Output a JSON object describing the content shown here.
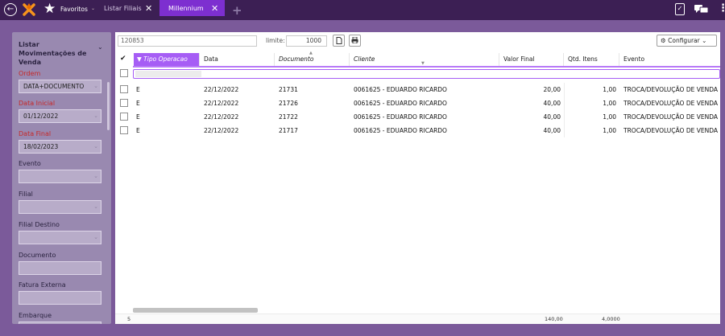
{
  "topbar": {
    "favorites_label": "Favoritos",
    "tabs": [
      {
        "label": "Listar Filiais",
        "active": false
      },
      {
        "label": "Millennium",
        "active": true
      }
    ],
    "close_glyph": "✕",
    "add_glyph": "+"
  },
  "left_panel": {
    "title": "Listar Movimentações de Venda",
    "fields": [
      {
        "label": "Ordem",
        "value": "DATA+DOCUMENTO",
        "required": true
      },
      {
        "label": "Data Inicial",
        "value": "01/12/2022",
        "required": true
      },
      {
        "label": "Data Final",
        "value": "18/02/2023",
        "required": true
      },
      {
        "label": "Evento",
        "value": "",
        "required": false
      },
      {
        "label": "Filial",
        "value": "",
        "required": false
      },
      {
        "label": "Filial Destino",
        "value": "",
        "required": false
      },
      {
        "label": "Documento",
        "value": "",
        "required": false
      },
      {
        "label": "Fatura Externa",
        "value": "",
        "required": false
      },
      {
        "label": "Embarque",
        "value": "",
        "required": false
      }
    ]
  },
  "toolbar": {
    "search_value": "120853",
    "limite_label": "limite:",
    "limite_value": "1000",
    "config_label": "Configurar"
  },
  "table": {
    "columns": [
      "Tipo Operacao",
      "Data",
      "Documento",
      "Cliente",
      "Valor Final",
      "Qtd. Itens",
      "Evento"
    ],
    "rows": [
      {
        "tipo": "E",
        "data": "22/12/2022",
        "documento": "21731",
        "cliente": "0061625 - EDUARDO RICARDO",
        "valor": "20,00",
        "qtd": "1,00",
        "evento": "TROCA/DEVOLUÇÃO DE VENDA"
      },
      {
        "tipo": "E",
        "data": "22/12/2022",
        "documento": "21726",
        "cliente": "0061625 - EDUARDO RICARDO",
        "valor": "40,00",
        "qtd": "1,00",
        "evento": "TROCA/DEVOLUÇÃO DE VENDA"
      },
      {
        "tipo": "E",
        "data": "22/12/2022",
        "documento": "21722",
        "cliente": "0061625 - EDUARDO RICARDO",
        "valor": "40,00",
        "qtd": "1,00",
        "evento": "TROCA/DEVOLUÇÃO DE VENDA"
      },
      {
        "tipo": "E",
        "data": "22/12/2022",
        "documento": "21717",
        "cliente": "0061625 - EDUARDO RICARDO",
        "valor": "40,00",
        "qtd": "1,00",
        "evento": "TROCA/DEVOLUÇÃO DE VENDA"
      }
    ],
    "footer": {
      "count": "5",
      "valor_total": "140,00",
      "qtd_total": "4,0000"
    }
  }
}
